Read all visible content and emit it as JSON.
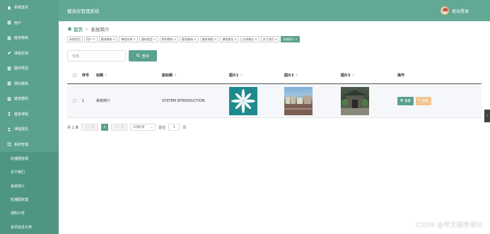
{
  "sidebar": {
    "items": [
      {
        "label": "系统首页",
        "icon": "home-icon"
      },
      {
        "label": "用户",
        "icon": "menu-icon"
      },
      {
        "label": "健身教练",
        "icon": "menu-icon"
      },
      {
        "label": "课程名称",
        "icon": "edit-icon"
      },
      {
        "label": "器材类型",
        "icon": "menu-icon"
      },
      {
        "label": "预约教练",
        "icon": "menu-icon"
      },
      {
        "label": "健身器材",
        "icon": "menu-icon"
      },
      {
        "label": "健身课程",
        "icon": "user-icon"
      },
      {
        "label": "课程报名",
        "icon": "user-icon"
      },
      {
        "label": "系统管理",
        "icon": "menu-icon"
      }
    ],
    "sub_items": [
      {
        "label": "轮播图管理"
      },
      {
        "label": "关于我们"
      },
      {
        "label": "系统简介"
      },
      {
        "label": "轮播图管理"
      },
      {
        "label": "通知公告"
      },
      {
        "label": "资讯信息分类"
      }
    ]
  },
  "header": {
    "title": "健身房管理系统",
    "logout": "退出登录"
  },
  "breadcrumb": {
    "home": "首页",
    "separator": ">",
    "current": "系统简介"
  },
  "tags": [
    "系统首页",
    "用户 ×",
    "健身教练 ×",
    "课程名称 ×",
    "器材类型 ×",
    "预约教练 ×",
    "健身器材 ×",
    "健身课程 ×",
    "课程报名 ×",
    "反馈建议 ×",
    "关于我们 ×",
    "系统简介 ×"
  ],
  "search": {
    "placeholder": "标题",
    "button": "查询"
  },
  "table": {
    "headers": {
      "no": "序号",
      "title": "标题",
      "subtitle": "副标题",
      "img1": "图片1",
      "img2": "图片2",
      "img3": "图片3",
      "ops": "操作"
    },
    "rows": [
      {
        "no": "1",
        "title": "系统简介",
        "subtitle": "SYSTEM INTRODUCTION"
      }
    ],
    "view_label": "查看",
    "edit_label": "修改"
  },
  "pager": {
    "total": "共 1 条",
    "prev": "上一页",
    "page": "1",
    "next": "下一页",
    "size": "10条/页",
    "goto_prefix": "前往",
    "goto_value": "1",
    "goto_suffix": "页"
  },
  "watermark": "CSDN @毕文程序设计",
  "colors": {
    "primary": "#5aa28e",
    "header": "#62a995",
    "edit": "#f1c58f"
  }
}
